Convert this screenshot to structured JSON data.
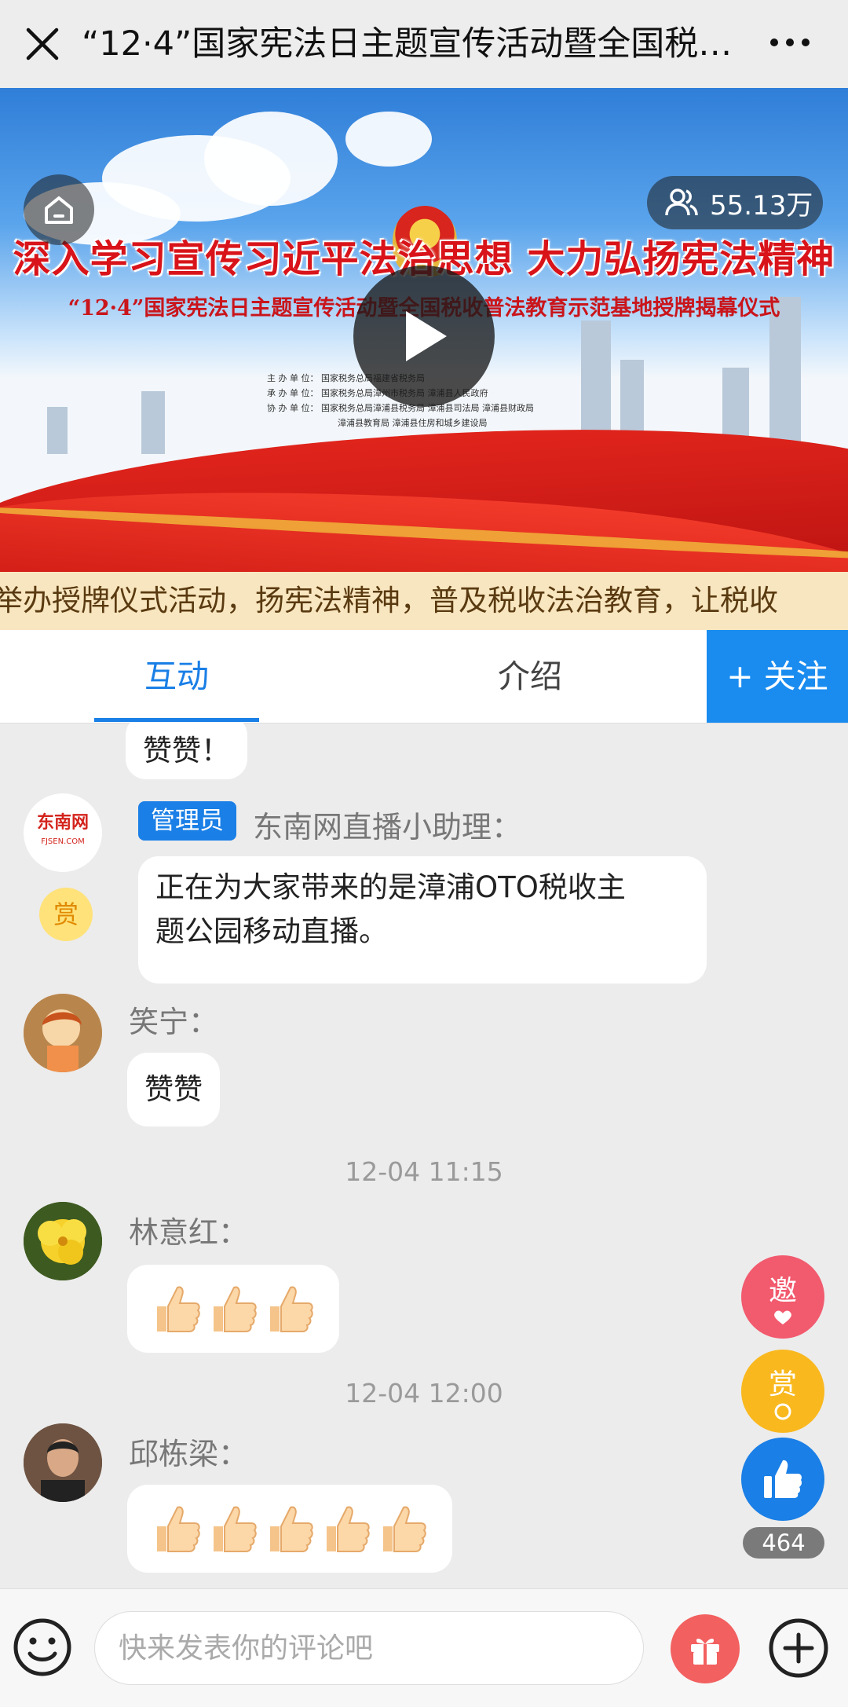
{
  "header": {
    "title": "“12·4”国家宪法日主题宣传活动暨全国税…"
  },
  "banner": {
    "headline": "深入学习宣传习近平法治思想 大力弘扬宪法精神",
    "subhead": "“12·4”国家宪法日主题宣传活动暨全国税收普法教育示范基地授牌揭幕仪式",
    "orgs": [
      "主 办 单 位：  国家税务总局福建省税务局",
      "承 办 单 位：  国家税务总局漳州市税务局   漳浦县人民政府",
      "协 办 单 位：  国家税务总局漳浦县税务局   漳浦县司法局   漳浦县财政局",
      "                         漳浦县教育局   漳浦县住房和城乡建设局"
    ],
    "viewer_count": "55.13万"
  },
  "ticker": {
    "text": "举办授牌仪式活动，扬宪法精神，普及税收法治教育，让税收"
  },
  "tabs": {
    "interact": "互动",
    "intro": "介绍",
    "follow": "+ 关注"
  },
  "chat": {
    "messages": [
      {
        "user": "",
        "text": "赞赞！"
      },
      {
        "badge": "管理员",
        "user": "东南网直播小助理：",
        "logo": "东南网",
        "logo_sub": "FJSEN.COM",
        "text_line1": "正在为大家带来的是漳浦OTO税收主",
        "text_line2": "题公园移动直播。"
      },
      {
        "user": "笑宁：",
        "text": "赞赞"
      },
      {
        "time": "12-04 11:15"
      },
      {
        "user": "林意红："
      },
      {
        "time": "12-04 12:00"
      },
      {
        "user": "邱栋梁："
      }
    ],
    "reward_mini": "赏"
  },
  "floating": {
    "invite": "邀",
    "reward": "赏",
    "like_count": "464"
  },
  "bottom": {
    "placeholder": "快来发表你的评论吧"
  },
  "colors": {
    "accent": "#1a7fe6",
    "follow_bg": "#1a8cf0",
    "invite": "#f25a6e",
    "reward": "#f9b81e",
    "gift": "#f2605f"
  }
}
